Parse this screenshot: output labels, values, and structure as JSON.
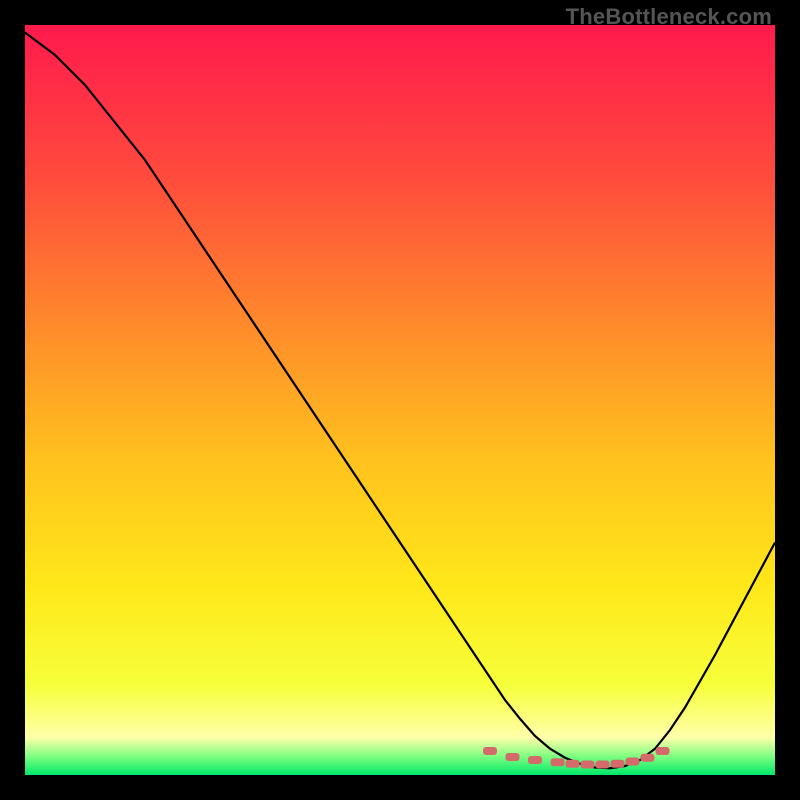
{
  "watermark": "TheBottleneck.com",
  "chart_data": {
    "type": "line",
    "title": "",
    "xlabel": "",
    "ylabel": "",
    "xlim": [
      0,
      100
    ],
    "ylim": [
      0,
      100
    ],
    "grid": false,
    "legend": false,
    "background_gradient": {
      "stops": [
        {
          "pos": 0.0,
          "color": "#ff1a4d"
        },
        {
          "pos": 0.2,
          "color": "#ff4a3d"
        },
        {
          "pos": 0.4,
          "color": "#ff8a2b"
        },
        {
          "pos": 0.58,
          "color": "#ffc21e"
        },
        {
          "pos": 0.75,
          "color": "#ffe81a"
        },
        {
          "pos": 0.88,
          "color": "#f6ff3a"
        },
        {
          "pos": 0.95,
          "color": "#ffffaa"
        },
        {
          "pos": 0.975,
          "color": "#7fff7f"
        },
        {
          "pos": 1.0,
          "color": "#00e86b"
        }
      ]
    },
    "series": [
      {
        "name": "bottleneck-curve",
        "stroke": "#000000",
        "x": [
          0,
          4,
          8,
          12,
          16,
          20,
          24,
          28,
          32,
          36,
          40,
          44,
          48,
          52,
          56,
          60,
          62,
          64,
          66,
          68,
          70,
          72,
          74,
          76,
          78,
          80,
          82,
          84,
          86,
          88,
          92,
          96,
          100
        ],
        "y": [
          99,
          96,
          92,
          87,
          82,
          76,
          70,
          64,
          58,
          52,
          46,
          40,
          34,
          28,
          22,
          16,
          13,
          10,
          7.5,
          5.2,
          3.5,
          2.3,
          1.5,
          1.0,
          0.9,
          1.2,
          2.0,
          3.5,
          6.0,
          9.0,
          16.0,
          23.5,
          31.0
        ]
      }
    ],
    "optimal_markers": {
      "name": "optimal-range",
      "color": "#d46a6a",
      "x": [
        62,
        65,
        68,
        71,
        73,
        75,
        77,
        79,
        81,
        83,
        85
      ],
      "y": [
        3.2,
        2.4,
        2.0,
        1.7,
        1.5,
        1.4,
        1.4,
        1.5,
        1.8,
        2.3,
        3.2
      ]
    }
  }
}
